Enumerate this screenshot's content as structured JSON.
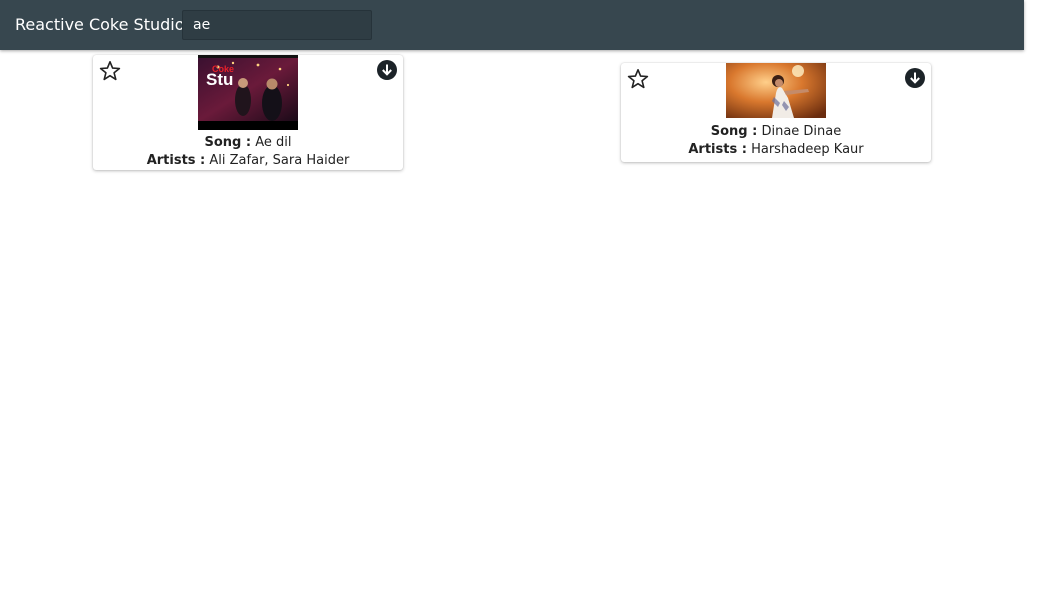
{
  "app": {
    "title": "Reactive Coke Studio"
  },
  "search": {
    "value": "ae",
    "placeholder": ""
  },
  "labels": {
    "song": "Song :",
    "artists": "Artists :"
  },
  "cards": [
    {
      "song": "Ae dil",
      "artists": "Ali Zafar, Sara Haider",
      "favorite_icon": "star-outline-icon",
      "download_icon": "download-circle-icon",
      "thumbnail_text": "Coke Studio"
    },
    {
      "song": "Dinae Dinae",
      "artists": "Harshadeep Kaur",
      "favorite_icon": "star-outline-icon",
      "download_icon": "download-circle-icon"
    }
  ],
  "colors": {
    "navbar": "#37474f",
    "search_bg": "#2f3d44",
    "icon_dark": "#1c2328"
  }
}
